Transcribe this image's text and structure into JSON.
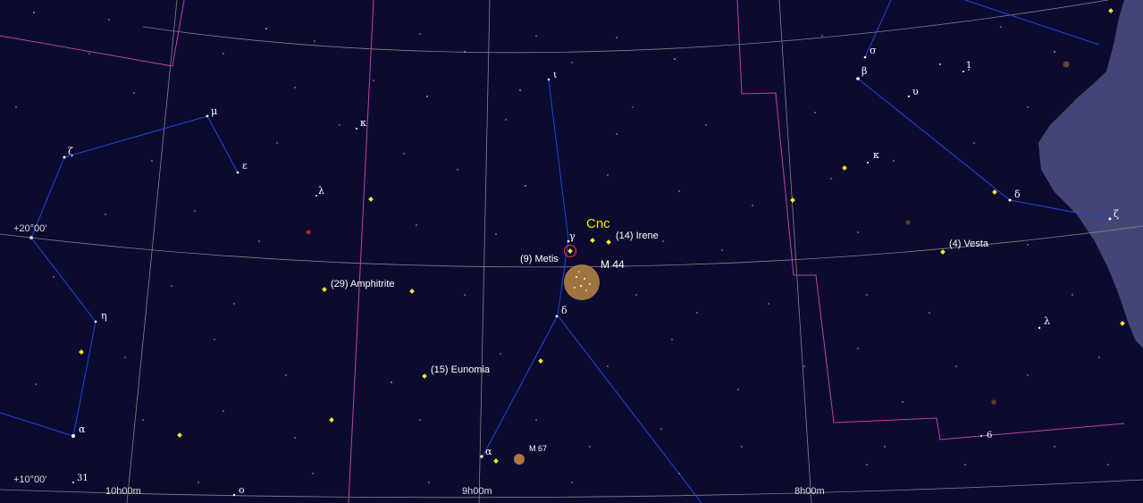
{
  "constellation_label": "Cnc",
  "coordinates": {
    "dec_20": "+20°00'",
    "dec_10": "+10°00'",
    "ra_10h": "10h00m",
    "ra_9h": "9h00m",
    "ra_8h": "8h00m"
  },
  "asteroids": {
    "metis": "(9) Metis",
    "irene": "(14) Irene",
    "amphitrite": "(29) Amphitrite",
    "eunomia": "(15) Eunomia",
    "vesta": "(4) Vesta"
  },
  "deep_sky": {
    "m44": "M 44",
    "m67": "M 67"
  },
  "star_labels": {
    "cnc_iota": "ι",
    "cnc_gamma": "γ",
    "cnc_delta": "δ",
    "cnc_alpha": "α",
    "lmi_kappa": "κ",
    "leo_mu": "μ",
    "leo_epsilon": "ε",
    "leo_zeta": "ζ",
    "leo_lambda": "λ",
    "leo_eta": "η",
    "leo_alpha": "α",
    "leo_31": "31",
    "leo_omicron": "ο",
    "gem_sigma": "σ",
    "gem_beta": "β",
    "gem_upsilon": "υ",
    "gem_1": "1",
    "gem_kappa": "κ",
    "gem_delta": "δ",
    "gem_zeta": "ζ",
    "gem_lambda": "λ",
    "cmi_6": "6"
  },
  "colors": {
    "background": "#0b0b30",
    "constellation_lines": "#1f3fd8",
    "boundaries": "#c83ca8",
    "grid": "#8a8a80",
    "asteroid": "#ffee22",
    "cluster": "#b08040",
    "milky_way": "#4a4c78"
  }
}
